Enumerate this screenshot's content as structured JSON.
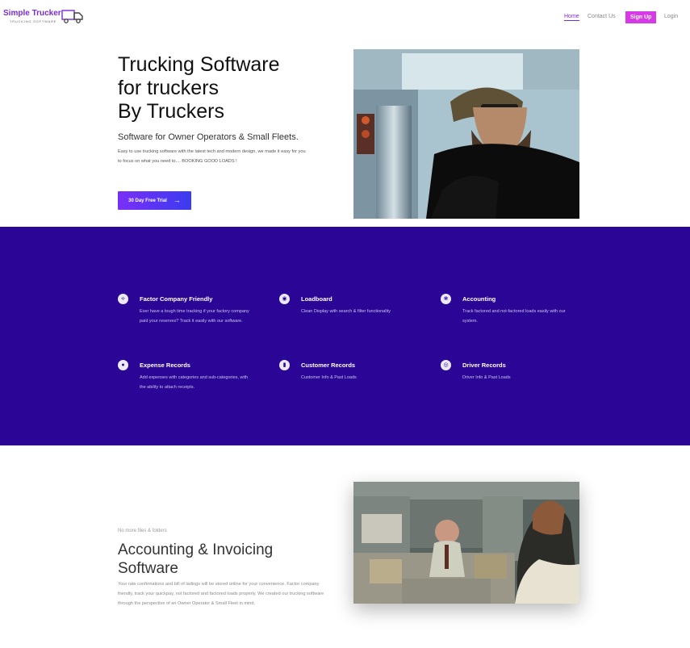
{
  "brand": {
    "name": "Simple Trucker",
    "tagline": "TRUCKING SOFTWARE",
    "color": "#7a2cd6"
  },
  "nav": {
    "home": "Home",
    "contact": "Contact Us",
    "signup": "Sign Up",
    "login": "Login"
  },
  "hero": {
    "title_lines": [
      "Trucking Software",
      "for truckers",
      "By Truckers"
    ],
    "subtitle": "Software for Owner Operators & Small Fleets.",
    "description": "Easy to use trucking software with the latest tech and modern design, we made it easy for you to focus on what you need to.... BOOKING GOOD LOADS !",
    "cta_label": "30 Day Free Trial",
    "cta_icon": "arrow-right-icon"
  },
  "features": {
    "background": "#2b0596",
    "items": [
      {
        "icon": "tag-icon",
        "title": "Factor Company Friendly",
        "description": "Ever have a tough time tracking if your factory company paid your reserves? Track it easily with our software."
      },
      {
        "icon": "target-icon",
        "title": "Loadboard",
        "description": "Clean Display with search & filter functionality"
      },
      {
        "icon": "paw-icon",
        "title": "Accounting",
        "description": "Track factored and not-factored loads easily with our system."
      },
      {
        "icon": "drop-icon",
        "title": "Expense Records",
        "description": "Add expenses with categories and sub-categories, with the ability to attach receipts."
      },
      {
        "icon": "thermometer-icon",
        "title": "Customer Records",
        "description": "Customer Info & Past Loads"
      },
      {
        "icon": "eye-icon",
        "title": "Driver Records",
        "description": "Driver Info & Past Loads"
      }
    ]
  },
  "accounting": {
    "eyebrow": "No more files & folders",
    "title_lines": [
      "Accounting & Invoicing",
      "Software"
    ],
    "description": "Your rate confirmations and bill of ladings will be stored online for your convenience. Factor company friendly, track your quickpay, not factored and factored loads properly. We created our trucking software through the perspective of an Owner Operator & Small Fleet in mind."
  }
}
